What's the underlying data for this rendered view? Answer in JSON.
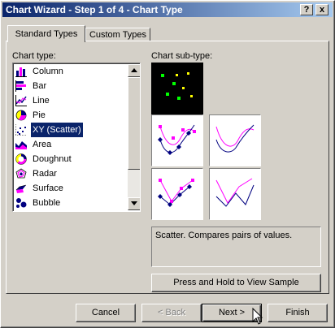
{
  "window": {
    "title": "Chart Wizard - Step 1 of 4 - Chart Type",
    "help_glyph": "?",
    "close_glyph": "x"
  },
  "tabs": [
    {
      "label": "Standard Types",
      "active": true
    },
    {
      "label": "Custom Types",
      "active": false
    }
  ],
  "chart_type": {
    "label": "Chart type:",
    "items": [
      {
        "label": "Column",
        "icon": "column-chart-icon"
      },
      {
        "label": "Bar",
        "icon": "bar-chart-icon"
      },
      {
        "label": "Line",
        "icon": "line-chart-icon"
      },
      {
        "label": "Pie",
        "icon": "pie-chart-icon"
      },
      {
        "label": "XY (Scatter)",
        "icon": "scatter-chart-icon",
        "selected": true
      },
      {
        "label": "Area",
        "icon": "area-chart-icon"
      },
      {
        "label": "Doughnut",
        "icon": "doughnut-chart-icon"
      },
      {
        "label": "Radar",
        "icon": "radar-chart-icon"
      },
      {
        "label": "Surface",
        "icon": "surface-chart-icon"
      },
      {
        "label": "Bubble",
        "icon": "bubble-chart-icon"
      }
    ]
  },
  "sub_type": {
    "label": "Chart sub-type:",
    "options": [
      {
        "icon": "scatter-markers-only-icon",
        "selected": true
      },
      {
        "icon": "scatter-smooth-markers-icon"
      },
      {
        "icon": "scatter-smooth-lines-icon"
      },
      {
        "icon": "scatter-straight-markers-icon"
      },
      {
        "icon": "scatter-straight-lines-icon"
      }
    ]
  },
  "description": "Scatter. Compares pairs of values.",
  "view_sample_button": "Press and Hold to View Sample",
  "buttons": {
    "cancel": "Cancel",
    "back": "< Back",
    "next": "Next >",
    "finish": "Finish"
  },
  "colors": {
    "titlebar_start": "#0a246a",
    "titlebar_end": "#a6caf0",
    "selection": "#0a246a",
    "marker_magenta": "#ff00ff",
    "series_navy": "#000080",
    "marker_green": "#00ff00",
    "marker_yellow": "#ffff00"
  }
}
